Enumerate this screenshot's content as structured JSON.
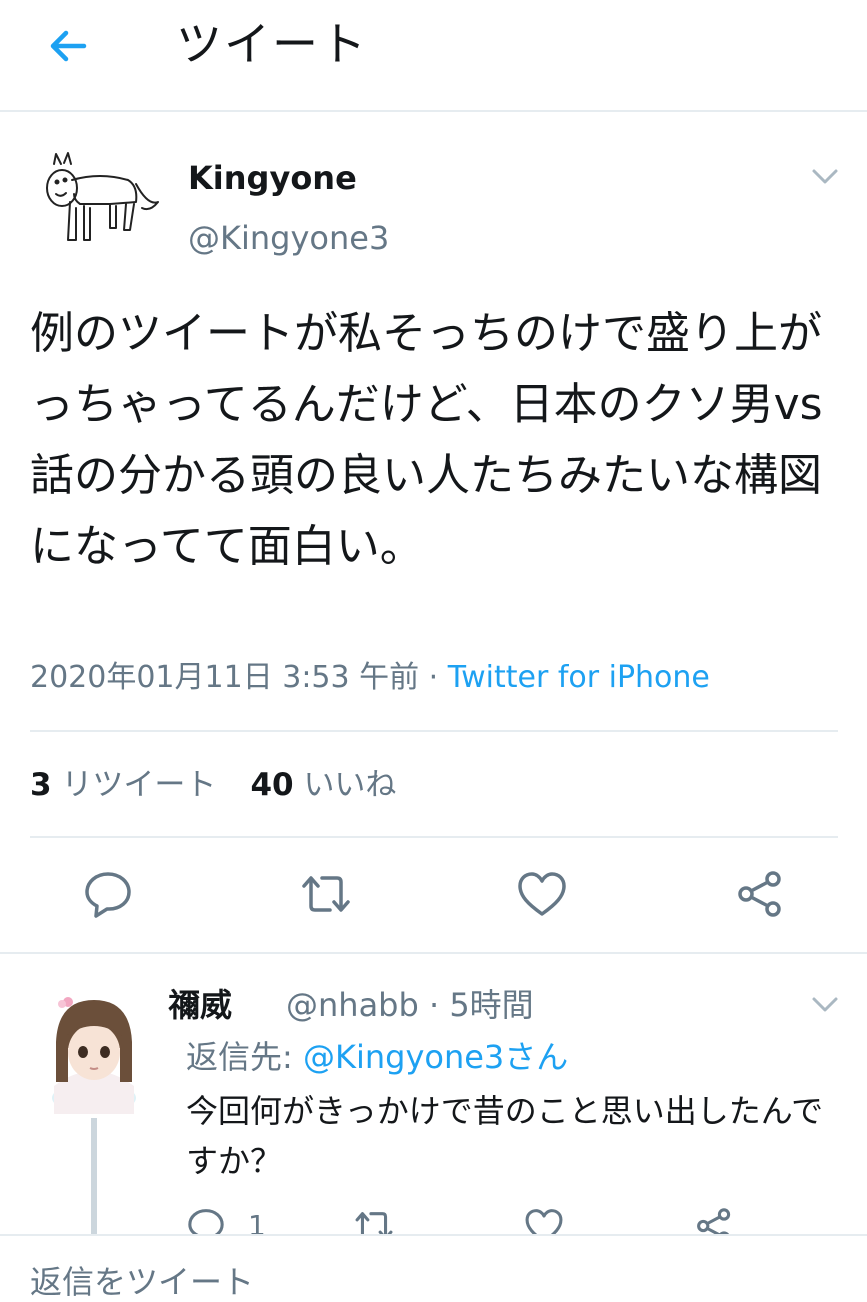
{
  "header": {
    "title": "ツイート"
  },
  "tweet": {
    "name": "Kingyone",
    "handle": "@Kingyone3",
    "text": "例のツイートが私そっちのけで盛り上がっちゃってるんだけど、日本のクソ男vs話の分かる頭の良い人たちみたいな構図になってて面白い。",
    "timestamp": "2020年01月11日 3:53 午前",
    "separator": " · ",
    "source": "Twitter for iPhone",
    "retweets": "3",
    "retweets_label": "リツイート",
    "likes": "40",
    "likes_label": "いいね"
  },
  "reply": {
    "name": "禰威",
    "handle": "@nhabb",
    "time": " · 5時間",
    "reply_prefix": "返信先: ",
    "reply_to": "@Kingyone3さん",
    "text": "今回何がきっかけで昔のこと思い出したんですか？",
    "reply_count": "1"
  },
  "compose": {
    "placeholder": "返信をツイート"
  },
  "colors": {
    "accent": "#1da1f2",
    "secondary_text": "#657786",
    "divider": "#e6ecf0"
  },
  "icons": [
    "back-arrow-icon",
    "chevron-down-icon",
    "reply-icon",
    "retweet-icon",
    "like-icon",
    "share-icon"
  ]
}
